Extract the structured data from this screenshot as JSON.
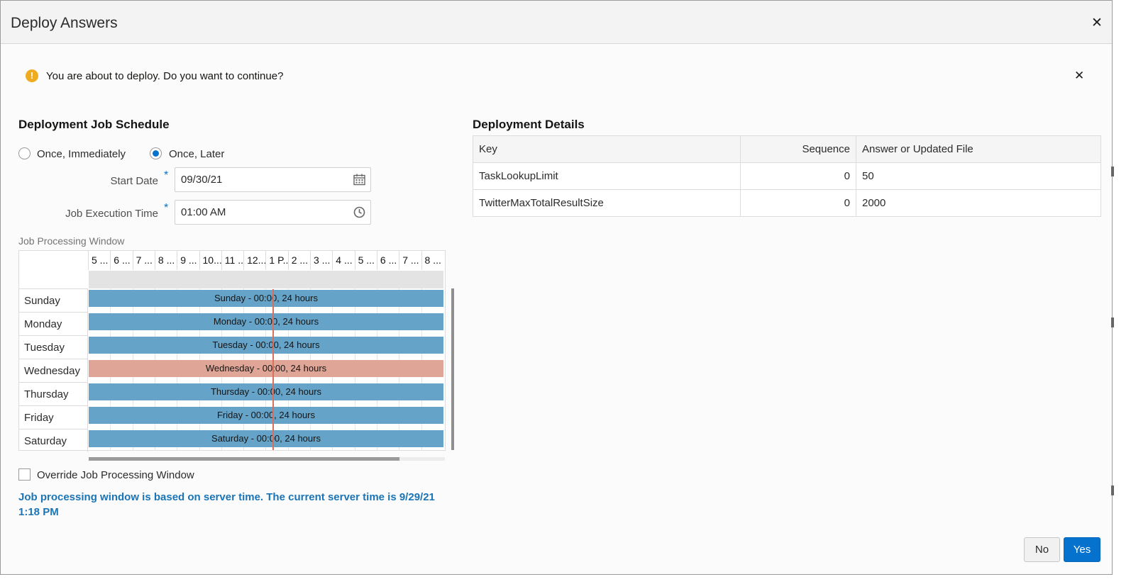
{
  "dialog": {
    "title": "Deploy Answers",
    "close_glyph": "✕"
  },
  "alert": {
    "icon": "warning-icon",
    "icon_glyph": "!",
    "message": "You are about to deploy. Do you want to continue?",
    "close_glyph": "✕"
  },
  "schedule": {
    "title": "Deployment Job Schedule",
    "options": [
      {
        "label": "Once, Immediately",
        "checked": false
      },
      {
        "label": "Once, Later",
        "checked": true
      }
    ],
    "start_date": {
      "label": "Start Date",
      "required": "*",
      "value": "09/30/21",
      "icon": "calendar-icon"
    },
    "exec_time": {
      "label": "Job Execution Time",
      "required": "*",
      "value": "01:00 AM",
      "icon": "clock-icon"
    },
    "window_label": "Job Processing Window",
    "time_headers": [
      "5 ...",
      "6 ...",
      "7 ...",
      "8 ...",
      "9 ...",
      "10...",
      "11 ...",
      "12...",
      "1 P...",
      "2 ...",
      "3 ...",
      "4 ...",
      "5 ...",
      "6 ...",
      "7 ...",
      "8 ..."
    ],
    "days": [
      {
        "day": "Sunday",
        "bar": "Sunday - 00:00, 24 hours",
        "color": "#65a3c9"
      },
      {
        "day": "Monday",
        "bar": "Monday - 00:00, 24 hours",
        "color": "#65a3c9"
      },
      {
        "day": "Tuesday",
        "bar": "Tuesday - 00:00, 24 hours",
        "color": "#65a3c9"
      },
      {
        "day": "Wednesday",
        "bar": "Wednesday - 00:00, 24 hours",
        "color": "#dfa597"
      },
      {
        "day": "Thursday",
        "bar": "Thursday - 00:00, 24 hours",
        "color": "#65a3c9"
      },
      {
        "day": "Friday",
        "bar": "Friday - 00:00, 24 hours",
        "color": "#65a3c9"
      },
      {
        "day": "Saturday",
        "bar": "Saturday - 00:00, 24 hours",
        "color": "#65a3c9"
      }
    ],
    "override_label": "Override Job Processing Window",
    "override_checked": false,
    "server_time_note": "Job processing window is based on server time. The current server time is 9/29/21 1:18 PM"
  },
  "details": {
    "title": "Deployment Details",
    "columns": [
      "Key",
      "Sequence",
      "Answer or Updated File"
    ],
    "rows": [
      [
        "TaskLookupLimit",
        "0",
        "50"
      ],
      [
        "TwitterMaxTotalResultSize",
        "0",
        "2000"
      ]
    ]
  },
  "buttons": {
    "no": "No",
    "yes": "Yes"
  },
  "colors": {
    "accent": "#0572ce",
    "warning": "#f0ac21",
    "bar_blue": "#65a3c9",
    "bar_highlight": "#dfa597",
    "now_line": "#d9705e",
    "info_text": "#1b74b5"
  }
}
